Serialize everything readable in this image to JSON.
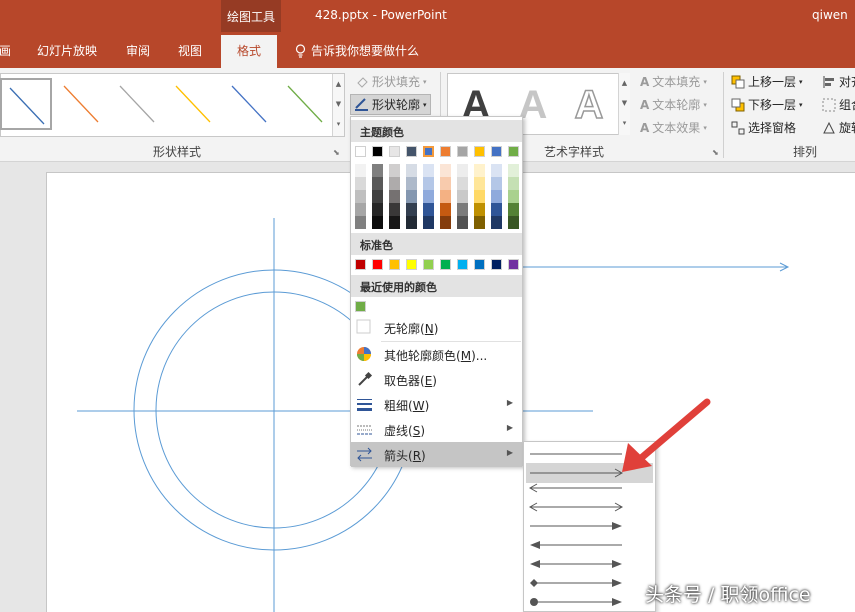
{
  "titlebar": {
    "context_tab": "绘图工具",
    "doc_title": "428.pptx - PowerPoint",
    "user": "qiwen"
  },
  "tabs": [
    {
      "label": "画",
      "active": false
    },
    {
      "label": "幻灯片放映",
      "active": false
    },
    {
      "label": "审阅",
      "active": false
    },
    {
      "label": "视图",
      "active": false
    },
    {
      "label": "格式",
      "active": true
    }
  ],
  "tell_me": "告诉我你想要做什么",
  "ribbon": {
    "shape_styles": {
      "label": "形状样式",
      "shape_fill": "形状填充",
      "shape_outline": "形状轮廓",
      "thumb_colors": [
        "#3b6fb4",
        "#ed7d31",
        "#a5a5a5",
        "#ffc000",
        "#4472c4",
        "#70ad47"
      ]
    },
    "wordart": {
      "label": "艺术字样式",
      "letter": "A",
      "text_fill": "文本填充",
      "text_outline": "文本轮廓",
      "text_effects": "文本效果"
    },
    "arrange": {
      "label": "排列",
      "bring_forward": "上移一层",
      "send_backward": "下移一层",
      "selection_pane": "选择窗格",
      "align": "对齐",
      "group": "组合",
      "rotate": "旋转"
    }
  },
  "outline_menu": {
    "theme_colors_header": "主题颜色",
    "theme_colors_top": [
      "#ffffff",
      "#000000",
      "#e7e6e6",
      "#44546a",
      "#4472c4",
      "#ed7d31",
      "#a5a5a5",
      "#ffc000",
      "#4472c4",
      "#70ad47"
    ],
    "theme_shades": [
      [
        "#f2f2f2",
        "#d9d9d9",
        "#bfbfbf",
        "#a6a6a6",
        "#808080"
      ],
      [
        "#7f7f7f",
        "#595959",
        "#404040",
        "#262626",
        "#0d0d0d"
      ],
      [
        "#d0cece",
        "#aeabab",
        "#757171",
        "#3a3838",
        "#171616"
      ],
      [
        "#d6dce5",
        "#adb9ca",
        "#8497b0",
        "#333f50",
        "#222a35"
      ],
      [
        "#dae3f3",
        "#b4c7e7",
        "#8faadc",
        "#2f5597",
        "#1f3864"
      ],
      [
        "#fbe5d6",
        "#f8cbad",
        "#f4b183",
        "#c55a11",
        "#843c0c"
      ],
      [
        "#ededed",
        "#dbdbdb",
        "#c9c9c9",
        "#7b7b7b",
        "#525252"
      ],
      [
        "#fff2cc",
        "#ffe699",
        "#ffd966",
        "#bf9000",
        "#7f6000"
      ],
      [
        "#dae3f3",
        "#b4c7e7",
        "#8faadc",
        "#2f5597",
        "#1f3864"
      ],
      [
        "#e2f0d9",
        "#c5e0b4",
        "#a9d18e",
        "#548235",
        "#385723"
      ]
    ],
    "standard_colors_header": "标准色",
    "standard_colors": [
      "#c00000",
      "#ff0000",
      "#ffc000",
      "#ffff00",
      "#92d050",
      "#00b050",
      "#00b0f0",
      "#0070c0",
      "#002060",
      "#7030a0"
    ],
    "recent_colors_header": "最近使用的颜色",
    "recent_colors": [
      "#70ad47"
    ],
    "no_outline": "无轮廓",
    "no_outline_key": "N",
    "more_colors": "其他轮廓颜色",
    "more_colors_key": "M",
    "more_colors_suffix": "...",
    "eyedropper": "取色器",
    "eyedropper_key": "E",
    "weight": "粗细",
    "weight_key": "W",
    "dashes": "虚线",
    "dashes_key": "S",
    "arrows": "箭头",
    "arrows_key": "R"
  },
  "accent_color": "#b7472a",
  "pointer_color": "#e0403a",
  "watermark": "头条号 / 职领office"
}
